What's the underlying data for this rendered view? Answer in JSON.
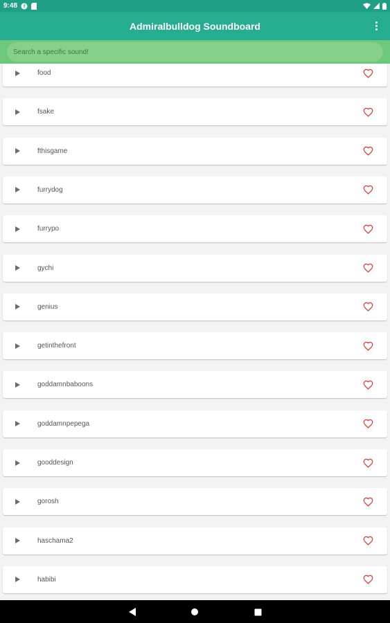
{
  "status_bar": {
    "time": "9:48",
    "icons": [
      "f-icon",
      "sim-card-icon",
      "wifi-icon",
      "signal-icon",
      "battery-icon"
    ]
  },
  "app_bar": {
    "title": "Admiralbulldog Soundboard",
    "menu_icon": "more-vert-icon"
  },
  "search": {
    "placeholder": "Search a specific sound!"
  },
  "sounds": [
    {
      "name": "food"
    },
    {
      "name": "fsake"
    },
    {
      "name": "fthisgame"
    },
    {
      "name": "furrydog"
    },
    {
      "name": "furrypo"
    },
    {
      "name": "gychi"
    },
    {
      "name": "genius"
    },
    {
      "name": "getinthefront"
    },
    {
      "name": "goddamnbaboons"
    },
    {
      "name": "goddamnpepega"
    },
    {
      "name": "gooddesign"
    },
    {
      "name": "gorosh"
    },
    {
      "name": "haschama2"
    },
    {
      "name": "habibi"
    }
  ],
  "item_icons": {
    "play": "play-icon",
    "favorite": "heart-outline-icon"
  },
  "nav_bar": {
    "buttons": [
      "back-icon",
      "home-icon",
      "recents-icon"
    ]
  },
  "colors": {
    "status_bar": "#1f9f86",
    "app_bar": "#26ad90",
    "search_bar": "#6cc87c",
    "heart": "#e53935",
    "background": "#f3f3f3"
  }
}
